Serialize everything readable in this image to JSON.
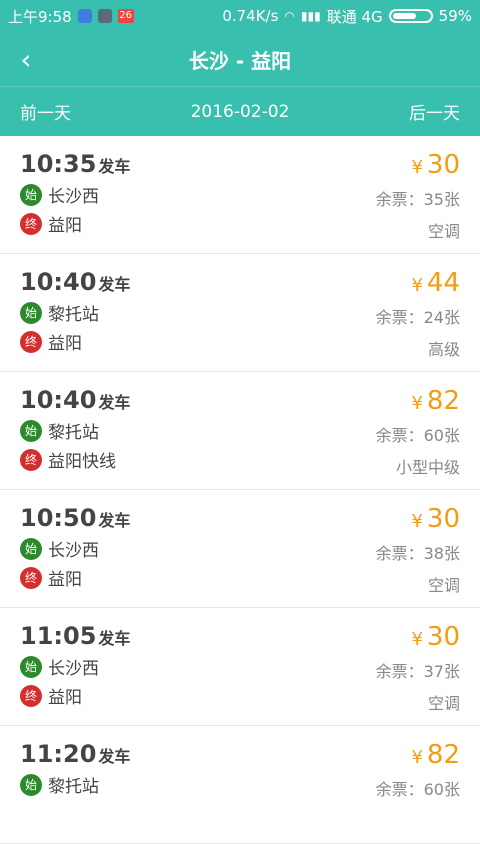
{
  "status_bar": {
    "time": "上午9:58",
    "badge": "26",
    "network_speed": "0.74K/s",
    "carrier": "联通 4G",
    "battery": "59%",
    "battery_level": 0.59
  },
  "header": {
    "title": "长沙 - 益阳"
  },
  "date_bar": {
    "prev_label": "前一天",
    "date": "2016-02-02",
    "next_label": "后一天"
  },
  "labels": {
    "depart_suffix": "发车",
    "start_tag": "始",
    "end_tag": "终",
    "currency": "¥"
  },
  "trips": [
    {
      "time": "10:35",
      "start": "长沙西",
      "end": "益阳",
      "price": "30",
      "remaining": "余票：35张",
      "bus_type": "空调"
    },
    {
      "time": "10:40",
      "start": "黎托站",
      "end": "益阳",
      "price": "44",
      "remaining": "余票：24张",
      "bus_type": "高级"
    },
    {
      "time": "10:40",
      "start": "黎托站",
      "end": "益阳快线",
      "price": "82",
      "remaining": "余票：60张",
      "bus_type": "小型中级"
    },
    {
      "time": "10:50",
      "start": "长沙西",
      "end": "益阳",
      "price": "30",
      "remaining": "余票：38张",
      "bus_type": "空调"
    },
    {
      "time": "11:05",
      "start": "长沙西",
      "end": "益阳",
      "price": "30",
      "remaining": "余票：37张",
      "bus_type": "空调"
    },
    {
      "time": "11:20",
      "start": "黎托站",
      "end": "",
      "price": "82",
      "remaining": "余票：60张",
      "bus_type": ""
    }
  ]
}
